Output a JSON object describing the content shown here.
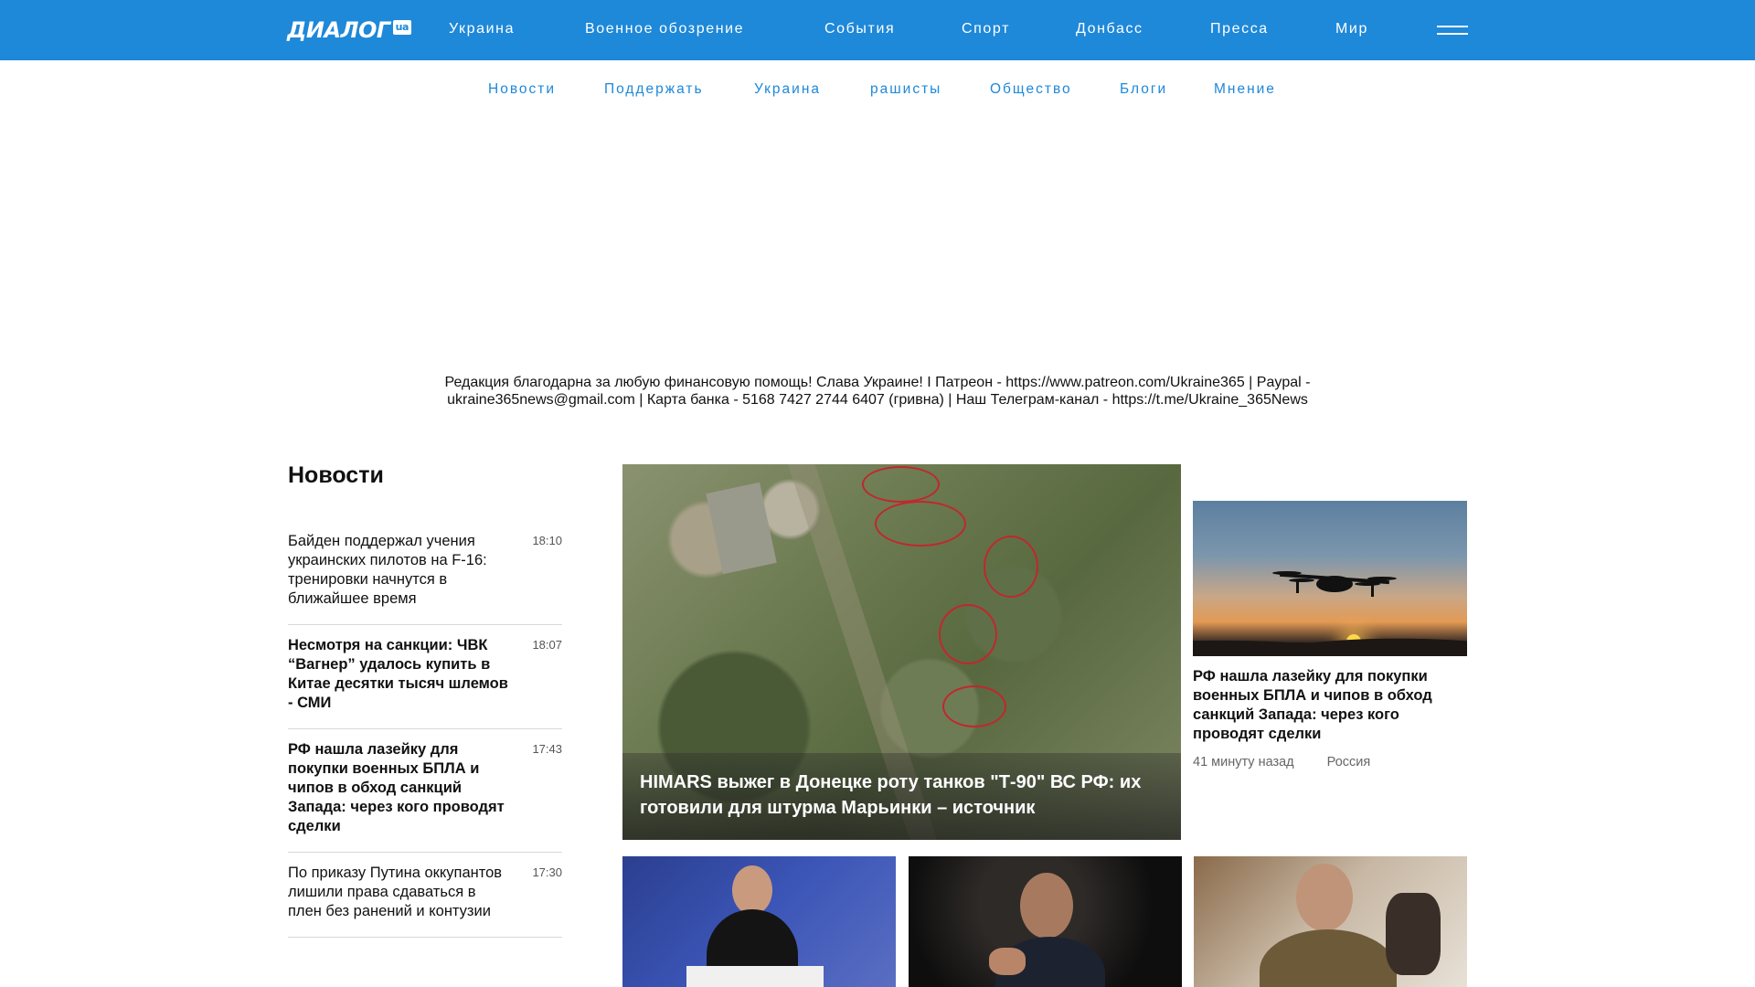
{
  "header": {
    "logo_text": "ДИАЛОГ",
    "logo_badge": "ua",
    "main_nav": [
      "Украина",
      "Военное обозрение",
      "События",
      "Спорт",
      "Донбасс",
      "Пресса",
      "Мир"
    ],
    "sub_nav": [
      "Новости",
      "Поддержать",
      "Украина",
      "рашисты",
      "Общество",
      "Блоги",
      "Мнение"
    ]
  },
  "notice": "Редакция благодарна за любую финансовую помощь! Слава Украине! I Патреон - https://www.patreon.com/Ukraine365 | Paypal - ukraine365news@gmail.com | Карта банка - 5168 7427 2744 6407 (гривна) | Наш Телеграм-канал - https://t.me/Ukraine_365News",
  "news": {
    "heading": "Новости",
    "items": [
      {
        "title": "Байден поддержал учения украинских пилотов на F-16: тренировки начнутся в ближайшее время",
        "time": "18:10",
        "bold": false
      },
      {
        "title": "Несмотря на санкции: ЧВК “Вагнер” удалось купить в Китае десятки тысяч шлемов - СМИ",
        "time": "18:07",
        "bold": true
      },
      {
        "title": "РФ нашла лазейку для покупки военных БПЛА и чипов в обход санкций Запада: через кого проводят сделки",
        "time": "17:43",
        "bold": true
      },
      {
        "title": "По приказу Путина оккупантов лишили права сдаваться в плен без ранений и контузии",
        "time": "17:30",
        "bold": false
      }
    ]
  },
  "featured": {
    "title": "HIMARS выжег в Донецке роту танков \"Т-90\" ВС РФ: их готовили для штурма Марьинки – источник"
  },
  "side_card": {
    "title": "РФ нашла лазейку для покупки военных БПЛА и чипов в обход санкций Запада: через кого проводят сделки",
    "time_ago": "41 минуту назад",
    "category": "Россия"
  },
  "colors": {
    "brand_blue": "#1e88d9"
  }
}
